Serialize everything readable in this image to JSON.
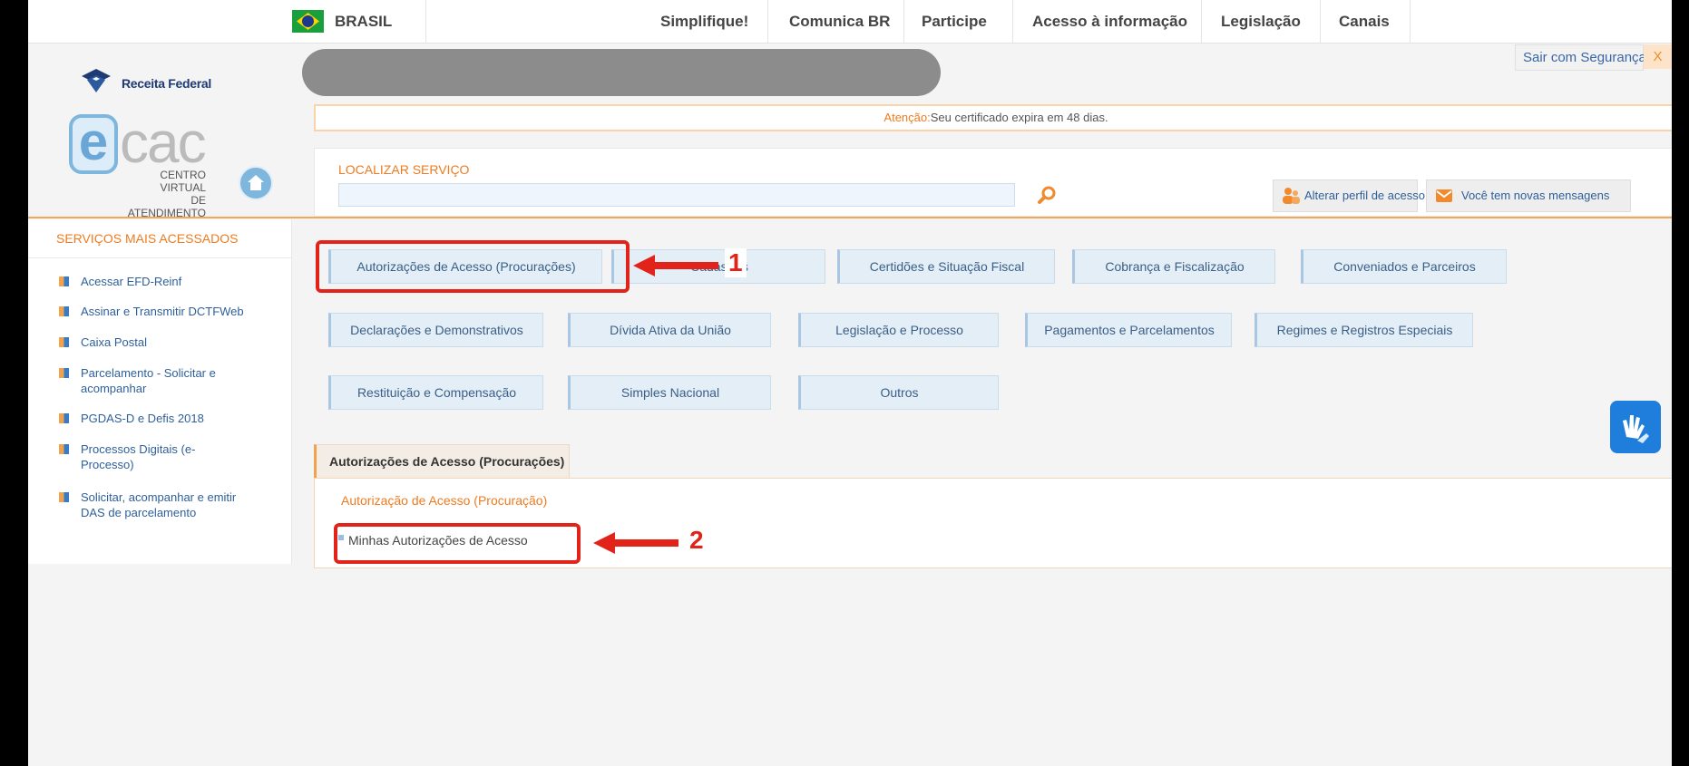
{
  "govbar": {
    "country": "BRASIL",
    "links": [
      "Simplifique!",
      "Comunica BR",
      "Participe",
      "Acesso à informação",
      "Legislação",
      "Canais"
    ]
  },
  "header": {
    "org_name": "Receita Federal",
    "logo_text": "cac",
    "logo_subtitle_1": "CENTRO VIRTUAL",
    "logo_subtitle_2": "DE ATENDIMENTO",
    "logout_label": "Sair com Segurança",
    "close_label": "X"
  },
  "alert": {
    "prefix": "Atenção:",
    "message": "Seu certificado expira em 48 dias."
  },
  "search": {
    "label": "LOCALIZAR SERVIÇO",
    "value": ""
  },
  "top_buttons": {
    "profile": "Alterar perfil de acesso",
    "messages": "Você tem novas mensagens"
  },
  "sidebar": {
    "title": "SERVIÇOS MAIS ACESSADOS",
    "items": [
      "Acessar EFD-Reinf",
      "Assinar e Transmitir DCTFWeb",
      "Caixa Postal",
      "Parcelamento - Solicitar e acompanhar",
      "PGDAS-D e Defis 2018",
      "Processos Digitais (e-Processo)",
      "Solicitar, acompanhar e emitir DAS de parcelamento"
    ]
  },
  "categories": [
    "Autorizações de Acesso (Procurações)",
    "Cadastros",
    "Certidões e Situação Fiscal",
    "Cobrança e Fiscalização",
    "Conveniados e Parceiros",
    "Declarações e Demonstrativos",
    "Dívida Ativa da União",
    "Legislação e Processo",
    "Pagamentos e Parcelamentos",
    "Regimes e Registros Especiais",
    "Restituição e Compensação",
    "Simples Nacional",
    "Outros"
  ],
  "panel": {
    "tab_label": "Autorizações de Acesso (Procurações)",
    "section_title": "Autorização de Acesso (Procuração)",
    "item": "Minhas Autorizações de Acesso"
  },
  "annotations": {
    "step1": "1",
    "step2": "2",
    "color": "#e2231a"
  }
}
